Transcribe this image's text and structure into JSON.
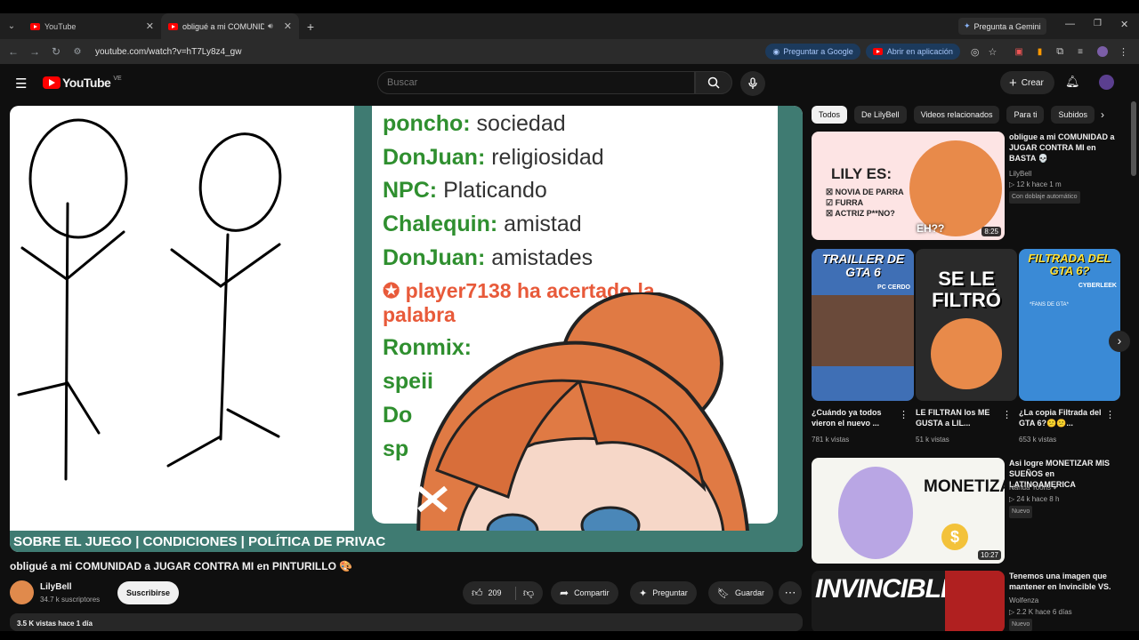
{
  "browser": {
    "tabs": [
      {
        "label": "YouTube"
      },
      {
        "label": "obligué a mi COMUNIDAD"
      }
    ],
    "gemini_label": "Pregunta a Gemini",
    "url": "youtube.com/watch?v=hT7Ly8z4_gw",
    "ask_google": "Preguntar a Google",
    "open_app": "Abrir en aplicación"
  },
  "youtube": {
    "brand": "YouTube",
    "country": "VE",
    "search_placeholder": "Buscar",
    "create_label": "Crear"
  },
  "video": {
    "chat_lines": [
      {
        "user": "poncho:",
        "msg": "sociedad"
      },
      {
        "user": "DonJuan:",
        "msg": "religiosidad"
      },
      {
        "user": "NPC:",
        "msg": "Platicando"
      },
      {
        "user": "Chalequin:",
        "msg": "amistad"
      },
      {
        "user": "DonJuan:",
        "msg": "amistades"
      }
    ],
    "winner_line1": "player7138 ha acertado la",
    "winner_line2": "palabra",
    "partial_lines": [
      "Ronmix:",
      "speii",
      "Do",
      "sp"
    ],
    "footer": "SOBRE EL JUEGO   |   CONDICIONES   |   POLÍTICA DE PRIVAC",
    "title": "obligué a mi COMUNIDAD a JUGAR CONTRA MI en PINTURILLO 🎨",
    "channel": "LilyBell",
    "subs": "34.7 k suscriptores",
    "subscribe": "Suscribirse",
    "likes": "209",
    "share": "Compartir",
    "ask": "Preguntar",
    "save": "Guardar",
    "views_partial": "3.5 K vistas  hace 1 día"
  },
  "filters": [
    "Todos",
    "De LilyBell",
    "Videos relacionados",
    "Para ti",
    "Subidos"
  ],
  "recommendations": {
    "r1": {
      "title": "obligue a mi COMUNIDAD a JUGAR CONTRA MI en BASTA 💀",
      "channel": "LilyBell",
      "meta": "▷ 12 k  hace 1 m",
      "badge": "Con doblaje automático",
      "duration": "8:25",
      "thumb_text": "LILY ES:",
      "thumb_items": [
        "NOVIA DE PARRA",
        "FURRA",
        "ACTRIZ P**NO?"
      ],
      "thumb_eh": "EH??"
    },
    "shorts": [
      {
        "thumb_text": "TRAILLER DE GTA 6",
        "tag": "PC CERDO",
        "title": "¿Cuándo ya todos vieron el nuevo ...",
        "views": "781 k vistas"
      },
      {
        "thumb_text": "SE LE FILTRÓ",
        "title": "LE FILTRAN los ME GUSTA a LIL...",
        "views": "51 k vistas"
      },
      {
        "thumb_text": "FILTRADA DEL GTA 6?",
        "tag": "CYBERLEEK",
        "tag2": "*FANS DE GTA*",
        "title": "¿La copia Filtrada del GTA 6?😕😕...",
        "views": "653 k vistas"
      }
    ],
    "r2": {
      "title": "Asi logre MONETIZAR MIS SUEÑOS en LATINOAMERICA",
      "channel": "Nanda Toons",
      "meta": "▷ 24 k  hace 8 h",
      "badge": "Nuevo",
      "duration": "10:27",
      "thumb_text": "MONETIZA"
    },
    "r3": {
      "title": "Tenemos una imagen que mantener en Invincible VS.",
      "channel": "Wolfenza",
      "meta": "▷ 2.2 K  hace 6 días",
      "badge": "Nuevo",
      "thumb_text": "INVINCIBLE"
    }
  }
}
